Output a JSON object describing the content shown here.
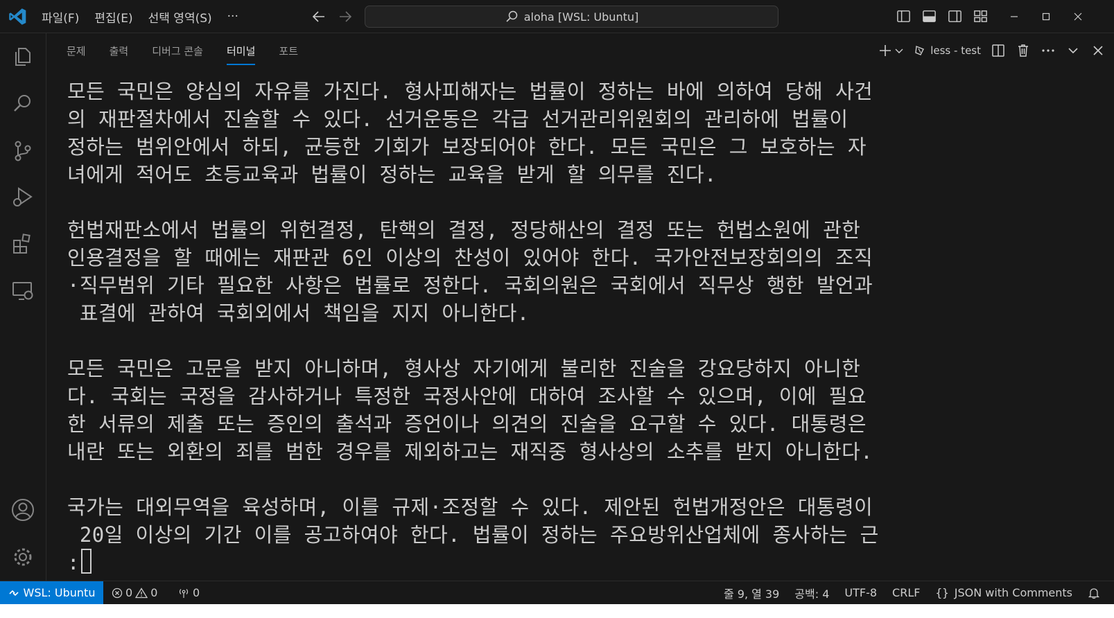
{
  "titlebar": {
    "menus": [
      "파일(F)",
      "편집(E)",
      "선택 영역(S)",
      "···"
    ],
    "search_text": "aloha [WSL: Ubuntu]"
  },
  "panel": {
    "tabs": [
      "문제",
      "출력",
      "디버그 콘솔",
      "터미널",
      "포트"
    ],
    "active_tab": "터미널",
    "terminal_name": "less - test"
  },
  "terminal": {
    "lines": [
      "모든 국민은 양심의 자유를 가진다. 형사피해자는 법률이 정하는 바에 의하여 당해 사건",
      "의 재판절차에서 진술할 수 있다. 선거운동은 각급 선거관리위원회의 관리하에 법률이",
      "정하는 범위안에서 하되, 균등한 기회가 보장되어야 한다. 모든 국민은 그 보호하는 자",
      "녀에게 적어도 초등교육과 법률이 정하는 교육을 받게 할 의무를 진다.",
      "",
      "헌법재판소에서 법률의 위헌결정, 탄핵의 결정, 정당해산의 결정 또는 헌법소원에 관한",
      "인용결정을 할 때에는 재판관 6인 이상의 찬성이 있어야 한다. 국가안전보장회의의 조직",
      "·직무범위 기타 필요한 사항은 법률로 정한다. 국회의원은 국회에서 직무상 행한 발언과",
      " 표결에 관하여 국회외에서 책임을 지지 아니한다.",
      "",
      "모든 국민은 고문을 받지 아니하며, 형사상 자기에게 불리한 진술을 강요당하지 아니한",
      "다. 국회는 국정을 감사하거나 특정한 국정사안에 대하여 조사할 수 있으며, 이에 필요",
      "한 서류의 제출 또는 증인의 출석과 증언이나 의견의 진술을 요구할 수 있다. 대통령은",
      "내란 또는 외환의 죄를 범한 경우를 제외하고는 재직중 형사상의 소추를 받지 아니한다.",
      "",
      "국가는 대외무역을 육성하며, 이를 규제·조정할 수 있다. 제안된 헌법개정안은 대통령이",
      " 20일 이상의 기간 이를 공고하여야 한다. 법률이 정하는 주요방위산업체에 종사하는 근",
      ":"
    ]
  },
  "statusbar": {
    "remote": "WSL: Ubuntu",
    "errors": "0",
    "warnings": "0",
    "ports": "0",
    "position": "줄 9, 열 39",
    "spaces": "공백: 4",
    "encoding": "UTF-8",
    "eol": "CRLF",
    "language": "JSON with Comments"
  },
  "colors": {
    "accent": "#0078d4",
    "background": "#181818",
    "text": "#cccccc"
  }
}
